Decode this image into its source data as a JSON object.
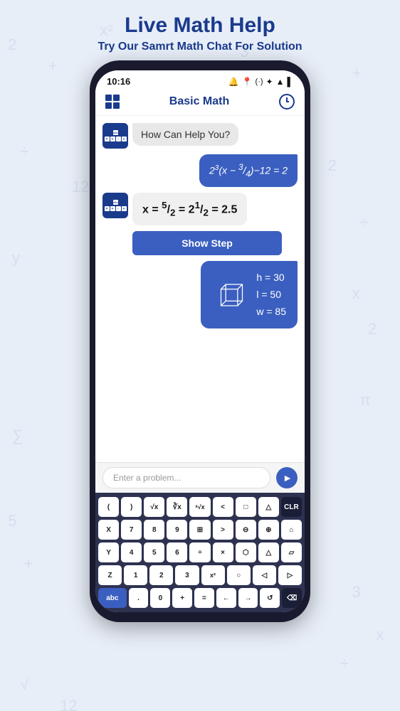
{
  "header": {
    "title": "Live Math Help",
    "subtitle": "Try Our Samrt Math Chat For Solution"
  },
  "phone": {
    "status": {
      "time": "10:16",
      "icons": [
        "🔔",
        "📍",
        "(·)",
        "✦",
        "▲",
        "▌"
      ]
    },
    "nav": {
      "title": "Basic Math"
    },
    "chat": {
      "bot_greeting": "How Can Help You?",
      "user_equation": "2³(x - 3/4) - 12 = 2",
      "answer_label": "x = 5/2 = 2½ = 2.5",
      "show_step": "Show Step",
      "shape_h": "h = 30",
      "shape_l": "l = 50",
      "shape_w": "w = 85"
    },
    "input": {
      "placeholder": "Enter a problem..."
    },
    "keyboard": {
      "rows": [
        [
          "(",
          ")",
          "√x",
          "∛x",
          "ˣ√x",
          "<",
          "□",
          "△",
          "CLR"
        ],
        [
          "X",
          "7",
          "8",
          "9",
          "⊡",
          ">",
          "⊖",
          "⊕",
          "⌂"
        ],
        [
          "Y",
          "4",
          "5",
          "6",
          "÷",
          "X",
          "⬡",
          "△",
          "▱"
        ],
        [
          "Z",
          "1",
          "2",
          "3",
          "x²",
          "○",
          "◁",
          "▷"
        ],
        [
          "abc",
          ".",
          "0",
          "+",
          "=",
          "←",
          "→",
          "↺",
          "⌫"
        ]
      ]
    }
  }
}
